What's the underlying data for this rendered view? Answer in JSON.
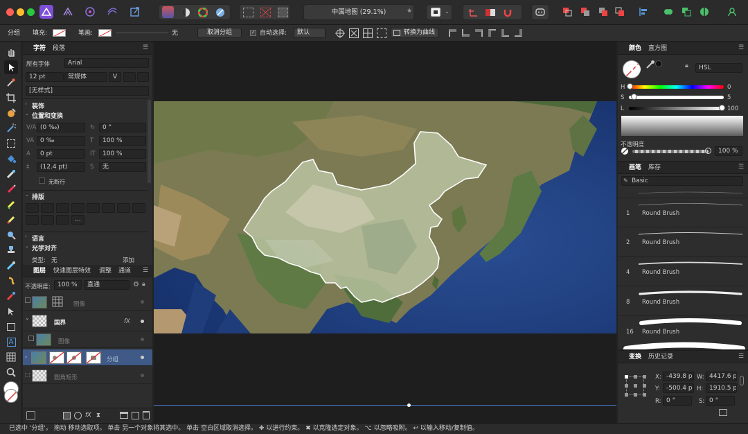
{
  "window": {
    "title": "中国地图 (29.1%)"
  },
  "context": {
    "group": "分组",
    "fill_label": "填充:",
    "stroke_label": "笔画:",
    "stroke_value": "无",
    "ungroup": "取消分组",
    "auto_select": "自动选择:",
    "auto_select_value": "默认",
    "to_curves": "转换为曲线"
  },
  "character": {
    "tab1": "字符",
    "tab2": "段落",
    "font_collection": "所有字体",
    "font": "Arial",
    "size": "12 pt",
    "style": "常规体",
    "style_preset": "[无样式]",
    "sec_decor": "装饰",
    "sec_pos": "位置和变换",
    "kern": "(0 ‰)",
    "rot": "0 °",
    "track": "0 ‰",
    "hscale": "100 %",
    "baseline": "0 pt",
    "vscale": "100 %",
    "lead": "(12.4 pt)",
    "skew": "无",
    "nobreak": "无断行",
    "sec_type": "排版",
    "more": "...",
    "sec_lang": "语言",
    "sec_optical": "光学对齐",
    "type_label": "类型:",
    "type_value": "无",
    "add": "添加"
  },
  "layers": {
    "tabs": [
      "图层",
      "快速图层特效",
      "调整",
      "通道"
    ],
    "opacity_label": "不透明度:",
    "opacity": "100 %",
    "blend": "直通",
    "items": [
      {
        "name": "图像",
        "dim": true
      },
      {
        "name": "国界",
        "dim": false
      },
      {
        "name": "图像",
        "dim": true
      },
      {
        "name": "分组",
        "dim": true
      },
      {
        "name": "圆角矩形",
        "dim": true
      }
    ]
  },
  "color": {
    "tab1": "颜色",
    "tab2": "直方图",
    "model": "HSL",
    "h_label": "H",
    "h": "0",
    "s_label": "S",
    "s": "5",
    "l_label": "L",
    "l": "100",
    "opacity_label": "不透明度",
    "opacity": "100 %"
  },
  "brushes": {
    "tab1": "画笔",
    "tab2": "库存",
    "category": "Basic",
    "items": [
      {
        "size": "1",
        "name": "Round Brush"
      },
      {
        "size": "2",
        "name": "Round Brush"
      },
      {
        "size": "4",
        "name": "Round Brush"
      },
      {
        "size": "8",
        "name": "Round Brush"
      },
      {
        "size": "16",
        "name": "Round Brush"
      }
    ]
  },
  "transform": {
    "tab1": "变换",
    "tab2": "历史记录",
    "x_label": "X:",
    "x": "-439.8 p",
    "y_label": "Y:",
    "y": "-500.4 p",
    "w_label": "W:",
    "w": "4417.6 pt",
    "h_label": "H:",
    "h": "1910.5 pt",
    "r_label": "R:",
    "r": "0 °",
    "s_label": "S:",
    "s": "0 °"
  },
  "status": {
    "text": "已选中 '分组'。 拖动 移动选取项。 单击 另一个对象将其选中。 单击 空白区域取消选择。 ✥ 以进行约束。 ✖ 以克隆选定对象。 ⌥ 以忽略吸附。 ↩ 以输入移动/复制值。"
  }
}
